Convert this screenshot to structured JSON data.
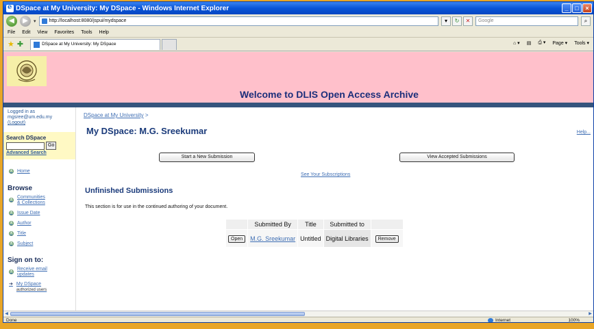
{
  "window": {
    "title": "DSpace at My University: My DSpace - Windows Internet Explorer",
    "address": "http://localhost:8080/jspui/mydspace",
    "search_placeholder": "Google",
    "menu": [
      "File",
      "Edit",
      "View",
      "Favorites",
      "Tools",
      "Help"
    ],
    "tab_title": "DSpace at My University: My DSpace",
    "tools": {
      "page": "Page ▾",
      "tools": "Tools ▾"
    }
  },
  "header": {
    "welcome": "Welcome to DLIS Open Access Archive"
  },
  "sidebar": {
    "logged_in_label": "Logged in as",
    "user_email": "mgsree@um.edu.my",
    "logout": "(Logout)",
    "search_heading": "Search DSpace",
    "go_label": "Go",
    "advanced_search": "Advanced Search",
    "home": "Home",
    "browse_heading": "Browse",
    "browse_items": [
      "Communities",
      "& Collections",
      "Issue Date",
      "Author",
      "Title",
      "Subject"
    ],
    "sign_on_heading": "Sign on to:",
    "receive_email": [
      "Receive email",
      "updates"
    ],
    "my_dspace": "My DSpace",
    "authorized_users": "authorized users"
  },
  "main": {
    "breadcrumb": "DSpace at My University",
    "breadcrumb_sep": ">",
    "title": "My DSpace: M.G. Sreekumar",
    "help": "Help...",
    "start_submission": "Start a New Submission",
    "view_accepted": "View Accepted Submissions",
    "see_subscriptions": "See Your Subscriptions",
    "unfinished_heading": "Unfinished Submissions",
    "unfinished_desc": "This section is for use in the continued authoring of your document.",
    "table": {
      "headers": [
        "Submitted By",
        "Title",
        "Submitted to"
      ],
      "row": {
        "open": "Open",
        "submitted_by": "M.G. Sreekumar",
        "title": "Untitled",
        "submitted_to": "Digital Libraries",
        "remove": "Remove"
      }
    }
  },
  "status": {
    "left": "Done",
    "zone": "Internet",
    "zoom": "100%"
  }
}
